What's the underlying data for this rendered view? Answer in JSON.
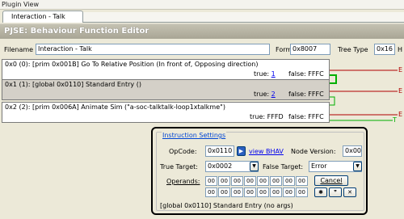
{
  "plugin_view": {
    "header": "Plugin View",
    "tab": "Interaction - Talk"
  },
  "editor": {
    "title": "PJSE: Behaviour Function Editor",
    "filename_label": "Filename",
    "filename_value": "Interaction - Talk",
    "format_label": "Format",
    "format_value": "0x8007",
    "tree_type_label": "Tree Type",
    "tree_type_value": "0x16",
    "trailing_label": "H"
  },
  "nodes": [
    {
      "text": "0x0 (0): [prim 0x001B] Go To Relative Position (In front of, Opposing direction)",
      "true_label": "true:",
      "true_value": "1",
      "false_label": "false:",
      "false_value": "FFFC",
      "edge_label": "E"
    },
    {
      "text": "0x1 (1): [global 0x0110] Standard Entry ()",
      "true_label": "true:",
      "true_value": "2",
      "false_label": "false:",
      "false_value": "FFFC",
      "edge_label": "E"
    },
    {
      "text": "0x2 (2): [prim 0x006A] Animate Sim (\"a-soc-talktalk-loop1xtalkme\")",
      "true_label": "true:",
      "true_value": "FFFD",
      "false_label": "false:",
      "false_value": "FFFC",
      "edge_label": "E",
      "edge_label_2": "T"
    }
  ],
  "instruction": {
    "group_label": "Instruction Settings",
    "opcode_label": "OpCode:",
    "opcode_value": "0x0110",
    "view_bhav": "view BHAV",
    "node_version_label": "Node Version:",
    "node_version_value": "0x00",
    "true_target_label": "True Target:",
    "true_target_value": "0x0002",
    "false_target_label": "False Target:",
    "false_target_value": "Error",
    "operands_label": "Operands:",
    "operands_row1": [
      "00",
      "00",
      "00",
      "00",
      "00",
      "00",
      "00",
      "00"
    ],
    "operands_row2": [
      "00",
      "00",
      "00",
      "00",
      "00",
      "00",
      "00",
      "00"
    ],
    "cancel_label": "Cancel",
    "status_text": "[global 0x0110] Standard Entry (no args)"
  },
  "colors": {
    "edge_red": "#b00000",
    "edge_green": "#00b000",
    "link": "#0000ee",
    "group_label": "#0046d5"
  }
}
